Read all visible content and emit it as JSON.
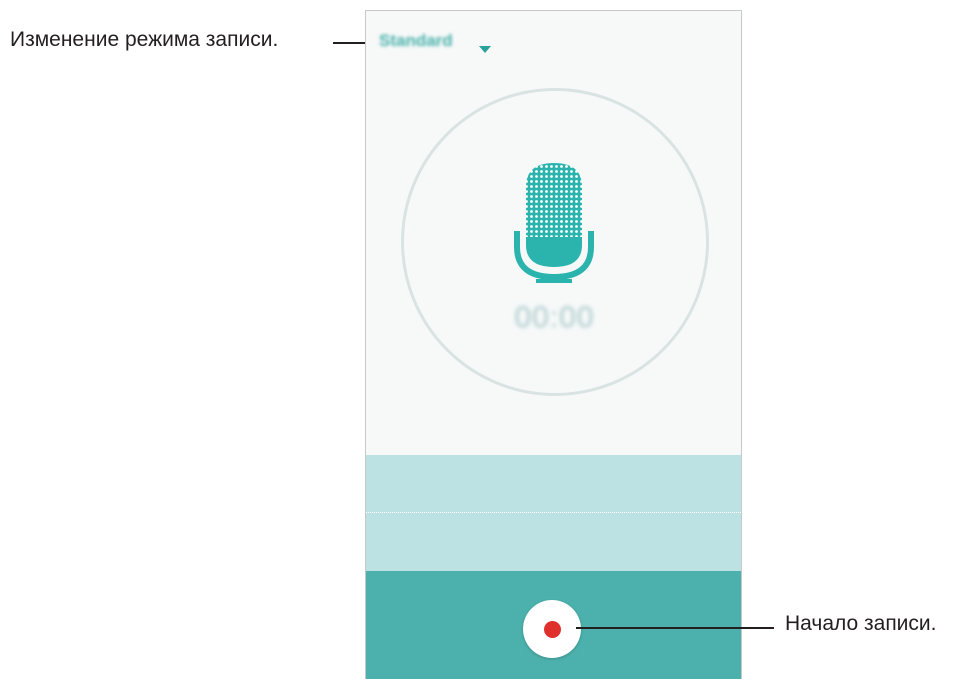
{
  "callouts": {
    "mode_change": "Изменение режима записи.",
    "start_recording": "Начало записи."
  },
  "recorder": {
    "mode_label": "Standard",
    "timer": "00:00"
  },
  "colors": {
    "accent": "#2aa19b",
    "control_bar": "#4cb1ad",
    "wave_area": "#bde2e3",
    "record_dot": "#e0302b"
  },
  "icons": {
    "mode_caret": "chevron-down-icon",
    "microphone": "microphone-icon",
    "record": "record-dot-icon"
  }
}
